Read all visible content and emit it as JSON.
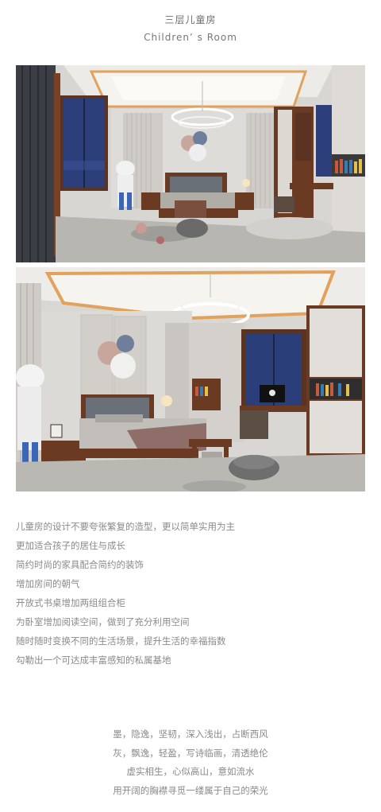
{
  "header": {
    "title_zh": "三层儿童房",
    "title_en": "Children’ s Room"
  },
  "images": [
    {
      "alt": "children-room-render-front"
    },
    {
      "alt": "children-room-render-angle"
    }
  ],
  "body_lines": [
    "儿童房的设计不要夸张繁复的造型，更以简单实用为主",
    "更加适合孩子的居住与成长",
    "简约时尚的家具配合简约的装饰",
    "增加房间的朝气",
    "开放式书桌增加两组组合柜",
    "为卧室增加阅读空间，做到了充分利用空间",
    "随时随时变换不同的生活场景，提升生活的幸福指数",
    "勾勒出一个可达成丰富感知的私属基地"
  ],
  "poem_lines": [
    "墨，隐逸，坚韧，深入浅出，占断西风",
    "灰，飘逸，轻盈，写诗临画，清透绝伦",
    "虚实相生，心似高山，意如流水",
    "用开阔的胸襟寻觅一缕属于自己的荣光"
  ],
  "colors": {
    "walnut": "#6b3a22",
    "wall": "#dcdad6",
    "ceiling": "#eeede9",
    "night_window": "#2a3f78",
    "floor": "#b9b7b3",
    "text": "#8a8a8a"
  }
}
